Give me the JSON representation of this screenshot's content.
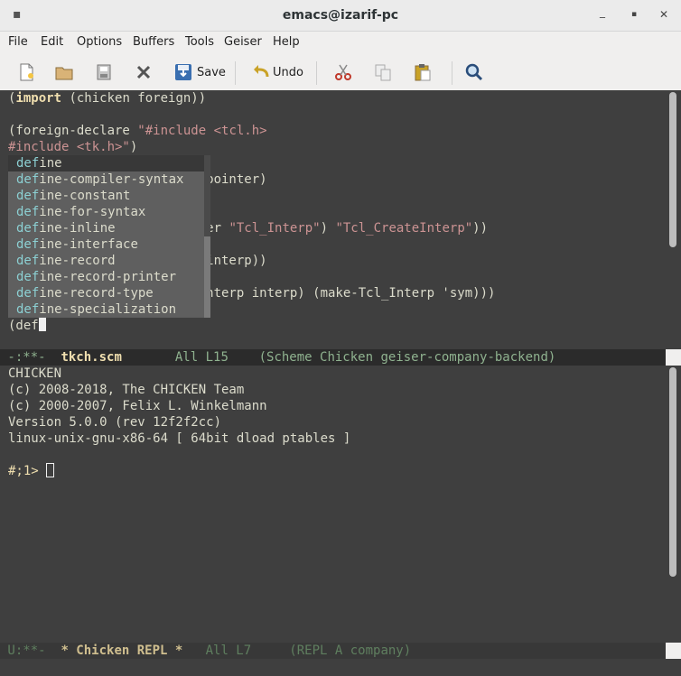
{
  "window": {
    "title": "emacs@izarif-pc",
    "menu_glyph": "▪",
    "minimize": "_",
    "maximize": "▪",
    "close": "✕"
  },
  "menubar": {
    "items": [
      "File",
      "Edit",
      "Options",
      "Buffers",
      "Tools",
      "Geiser",
      "Help"
    ]
  },
  "toolbar": {
    "save_label": "Save",
    "undo_label": "Undo"
  },
  "editor": {
    "lines": [
      {
        "parts": [
          {
            "t": "(",
            "c": ""
          },
          {
            "t": "import",
            "c": "kw"
          },
          {
            "t": " (chicken foreign))",
            "c": ""
          }
        ]
      },
      {
        "parts": []
      },
      {
        "parts": [
          {
            "t": "(foreign-declare ",
            "c": ""
          },
          {
            "t": "\"#include <tcl.h>",
            "c": "str"
          }
        ]
      },
      {
        "parts": [
          {
            "t": "#include <tk.h>\"",
            "c": "str"
          },
          {
            "t": ")",
            "c": ""
          }
        ]
      },
      {
        "parts": []
      },
      {
        "parts": [
          {
            "t": "                          pointer)",
            "c": ""
          }
        ]
      },
      {
        "parts": []
      },
      {
        "parts": [
          {
            "t": "                        nter ",
            "c": ""
          },
          {
            "t": "\"Tcl_Interp\"",
            "c": "str"
          },
          {
            "t": ") ",
            "c": ""
          },
          {
            "t": "\"Tcl_CreateInterp\"",
            "c": "str"
          },
          {
            "t": "))",
            "c": ""
          }
        ]
      },
      {
        "parts": []
      },
      {
        "parts": [
          {
            "t": "                        e-interp))",
            "c": ""
          }
        ]
      },
      {
        "parts": []
      },
      {
        "parts": [
          {
            "t": "                         Interp interp) (make-Tcl_Interp 'sym)))",
            "c": ""
          }
        ]
      },
      {
        "parts": []
      },
      {
        "parts": [
          {
            "t": "(def",
            "c": ""
          }
        ]
      }
    ],
    "completion": {
      "prefix": "def",
      "items": [
        "define",
        "define-compiler-syntax",
        "define-constant",
        "define-for-syntax",
        "define-inline",
        "define-interface",
        "define-record",
        "define-record-printer",
        "define-record-type",
        "define-specialization"
      ],
      "selected_index": 0
    }
  },
  "modeline_top": {
    "status": " -:**-  ",
    "buffer": "tkch.scm",
    "rest": "       All L15    (Scheme Chicken geiser-company-backend)"
  },
  "repl": {
    "lines": [
      "CHICKEN",
      "(c) 2008-2018, The CHICKEN Team",
      "(c) 2000-2007, Felix L. Winkelmann",
      "Version 5.0.0 (rev 12f2f2cc)",
      "linux-unix-gnu-x86-64 [ 64bit dload ptables ]",
      ""
    ],
    "prompt": "#;1> "
  },
  "modeline_bottom": {
    "status": " U:**-  ",
    "buffer": "* Chicken REPL *",
    "rest": "   All L7     (REPL A company)"
  }
}
